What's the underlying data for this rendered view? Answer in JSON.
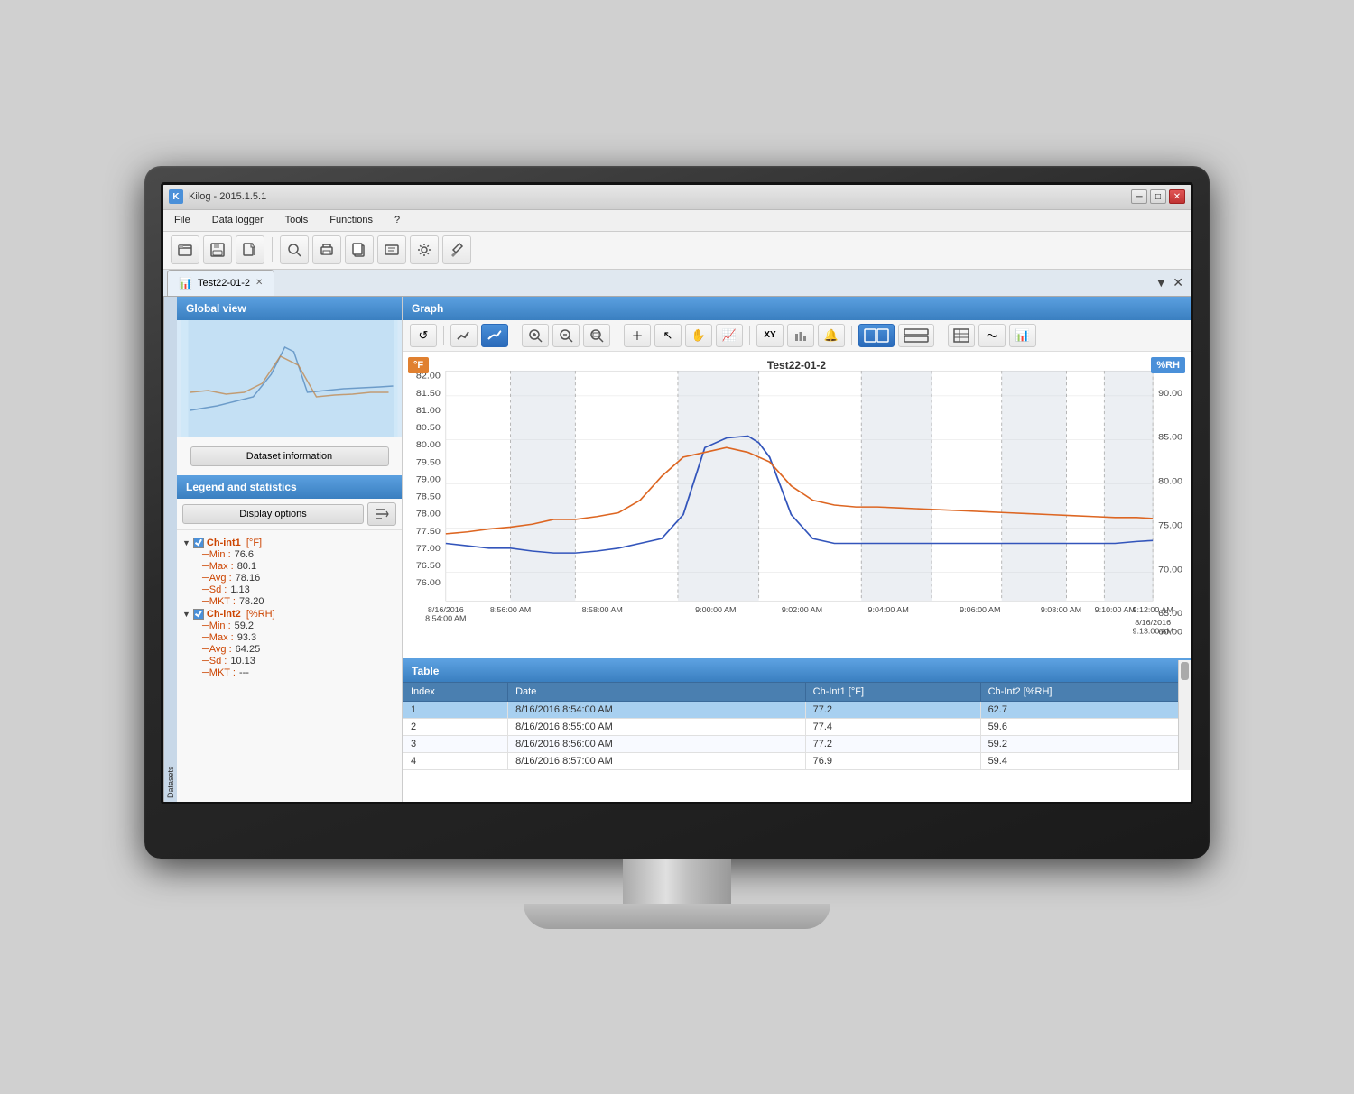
{
  "window": {
    "title": "Kilog - 2015.1.5.1",
    "tab_label": "Test22-01-2"
  },
  "menu": {
    "items": [
      "File",
      "Data logger",
      "Tools",
      "Functions",
      "?"
    ]
  },
  "toolbar": {
    "buttons": [
      "📂",
      "💾",
      "📄",
      "🔍",
      "🖨",
      "📋",
      "⚙"
    ]
  },
  "left_panel": {
    "global_view_label": "Global view",
    "dataset_info_btn": "Dataset information",
    "legend_label": "Legend and statistics",
    "display_options_btn": "Display options",
    "channels": [
      {
        "name": "Ch-int1",
        "unit": "[°F]",
        "checked": true,
        "color": "#cc4400",
        "stats": [
          {
            "key": "Min",
            "value": "76.6"
          },
          {
            "key": "Max",
            "value": "80.1"
          },
          {
            "key": "Avg",
            "value": "78.16"
          },
          {
            "key": "Sd",
            "value": "1.13"
          },
          {
            "key": "MKT",
            "value": "78.20"
          }
        ]
      },
      {
        "name": "Ch-int2",
        "unit": "[%RH]",
        "checked": true,
        "color": "#4a90d9",
        "stats": [
          {
            "key": "Min",
            "value": "59.2"
          },
          {
            "key": "Max",
            "value": "93.3"
          },
          {
            "key": "Avg",
            "value": "64.25"
          },
          {
            "key": "Sd",
            "value": "10.13"
          },
          {
            "key": "MKT",
            "value": "---"
          }
        ]
      }
    ]
  },
  "graph": {
    "title": "Graph",
    "chart_title": "Test22-01-2",
    "unit_left": "°F",
    "unit_right": "%RH",
    "x_labels": [
      "8/16/2016\n8:54:00 AM",
      "8:56:00 AM",
      "8:58:00 AM",
      "9:00:00 AM",
      "9:02:00 AM",
      "9:04:00 AM",
      "9:06:00 AM",
      "9:08:00 AM",
      "9:10:00 AM",
      "9:12:00 AM",
      "8/16/2016\n9:13:00 AM"
    ],
    "y_left": [
      "82.00",
      "81.50",
      "81.00",
      "80.50",
      "80.00",
      "79.50",
      "79.00",
      "78.50",
      "78.00",
      "77.50",
      "77.00",
      "76.50",
      "76.00"
    ],
    "y_right": [
      "90.00",
      "85.00",
      "80.00",
      "75.00",
      "70.00",
      "65.00",
      "60.00"
    ]
  },
  "table": {
    "title": "Table",
    "columns": [
      "Index",
      "Date",
      "Ch-Int1 [°F]",
      "Ch-Int2 [%RH]"
    ],
    "rows": [
      {
        "index": "1",
        "date": "8/16/2016 8:54:00 AM",
        "ch1": "77.2",
        "ch2": "62.7",
        "selected": true
      },
      {
        "index": "2",
        "date": "8/16/2016 8:55:00 AM",
        "ch1": "77.4",
        "ch2": "59.6",
        "selected": false
      },
      {
        "index": "3",
        "date": "8/16/2016 8:56:00 AM",
        "ch1": "77.2",
        "ch2": "59.2",
        "selected": false
      },
      {
        "index": "4",
        "date": "8/16/2016 8:57:00 AM",
        "ch1": "76.9",
        "ch2": "59.4",
        "selected": false
      }
    ]
  },
  "datasets_label": "Datasets"
}
